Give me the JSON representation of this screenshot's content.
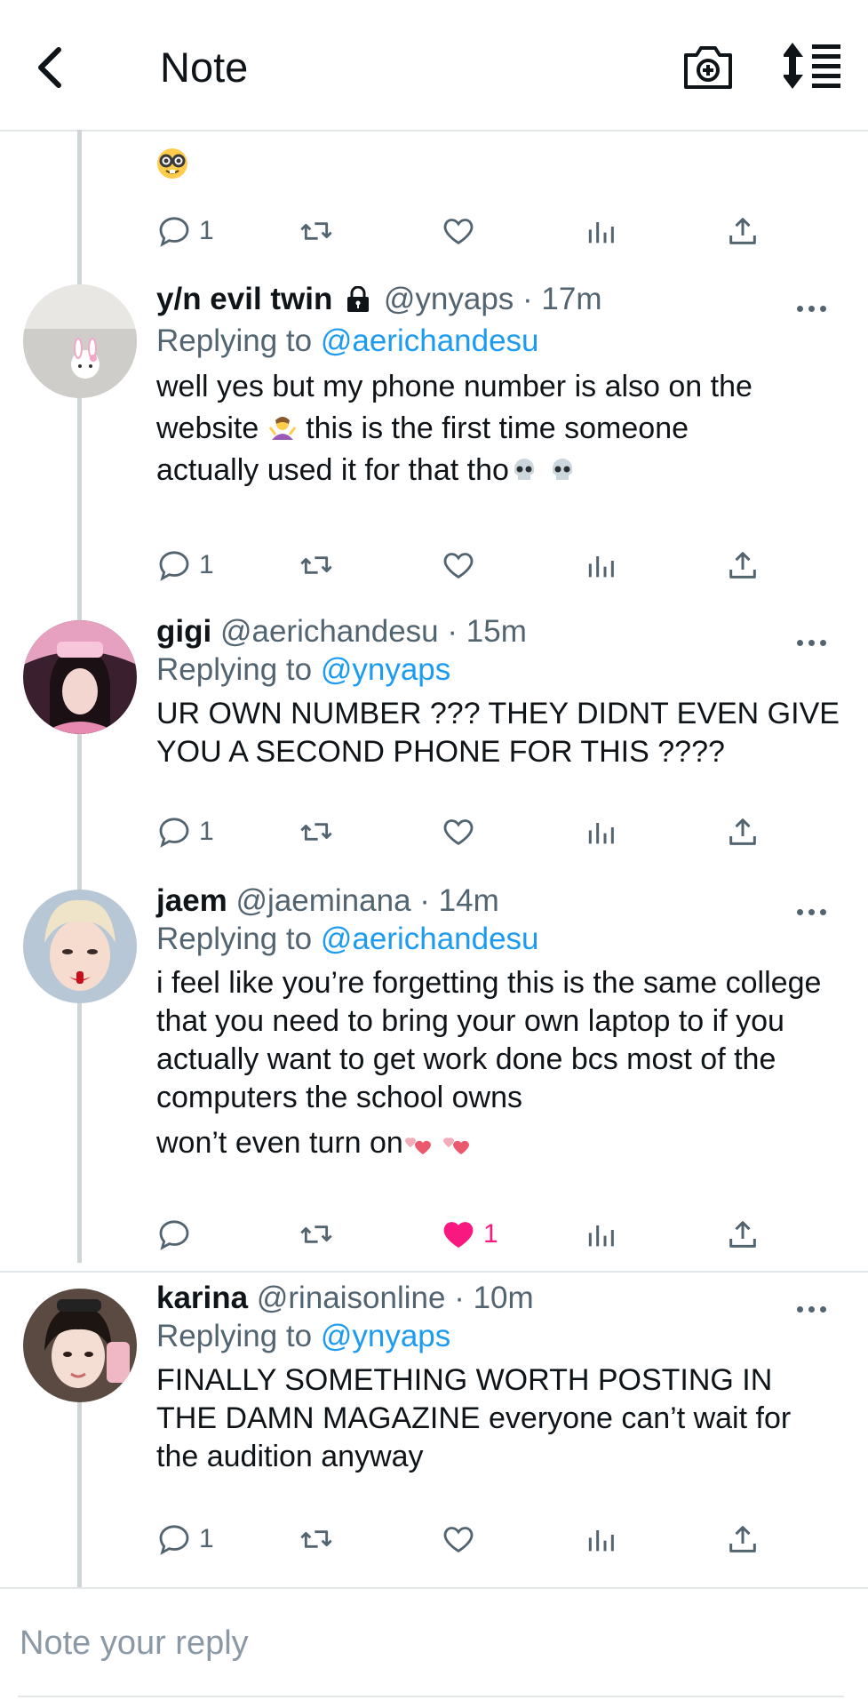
{
  "header": {
    "title": "Note"
  },
  "top_tweet": {
    "emoji_icon": "nerd-face-emoji",
    "actions": {
      "reply_count": "1"
    }
  },
  "tweets": [
    {
      "name": "y/n evil twin",
      "handle": "@ynyaps",
      "time": "17m",
      "replying_prefix": "Replying to",
      "replying_to": "@aerichandesu",
      "body_1": "well yes but my phone number is also on the",
      "body_2a": "website",
      "body_2b": "this is the first time someone",
      "body_3": "actually used it for that tho",
      "reply_count": "1",
      "like_count": ""
    },
    {
      "name": "gigi",
      "handle": "@aerichandesu",
      "time": "15m",
      "replying_prefix": "Replying to",
      "replying_to": "@ynyaps",
      "body": "UR OWN NUMBER ??? THEY DIDNT EVEN GIVE YOU A SECOND PHONE FOR THIS ????",
      "reply_count": "1",
      "like_count": ""
    },
    {
      "name": "jaem",
      "handle": "@jaeminana",
      "time": "14m",
      "replying_prefix": "Replying to",
      "replying_to": "@aerichandesu",
      "body": "i feel like you’re forgetting this is the same college that you need to bring your own laptop to if you actually want to get work done bcs most of the computers the school owns",
      "body_last": "won’t even turn on",
      "reply_count": "",
      "like_count": "1",
      "liked": true
    },
    {
      "name": "karina",
      "handle": "@rinaisonline",
      "time": "10m",
      "replying_prefix": "Replying to",
      "replying_to": "@ynyaps",
      "body": "FINALLY SOMETHING WORTH POSTING IN THE DAMN MAGAZINE everyone can’t wait for the audition anyway",
      "reply_count": "1",
      "like_count": ""
    }
  ],
  "reply_box": {
    "placeholder": "Note your reply"
  },
  "colors": {
    "accent": "#1d9bf0",
    "like": "#f91880",
    "muted": "#536471"
  }
}
